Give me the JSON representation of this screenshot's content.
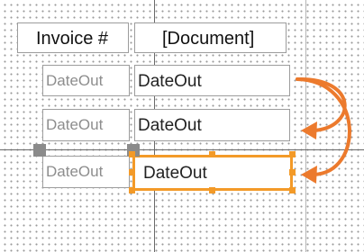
{
  "fields": {
    "invoice_label": "Invoice #",
    "document_value": "[Document]",
    "dateout_label_1": "DateOut",
    "dateout_value_1": "DateOut",
    "dateout_label_2": "DateOut",
    "dateout_value_2": "DateOut",
    "dateout_label_3": "DateOut",
    "dateout_value_3": "DateOut"
  },
  "colors": {
    "selection": "#f39a28",
    "arrow": "#ec7a2d",
    "anchor": "#8b8b8b",
    "grid_dot": "#9a9a9a"
  },
  "icons": {
    "arrow_1": "curved-arrow-icon",
    "arrow_2": "curved-arrow-icon"
  }
}
